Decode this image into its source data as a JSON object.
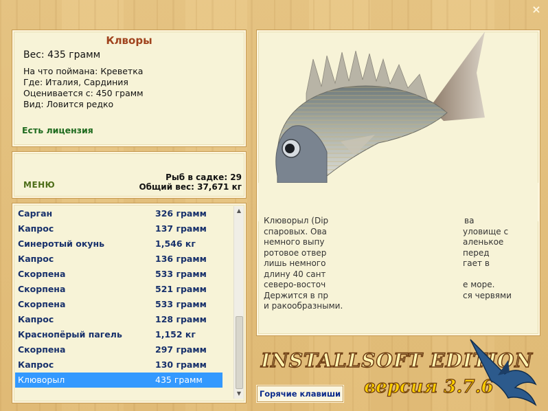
{
  "window": {
    "close_symbol": "×"
  },
  "catch": {
    "name": "Кл­воры­",
    "weight": "Вес: 435 грамм",
    "details": [
      "На что поймана: Креветка",
      "Где: Италия, Сардиния",
      "Оценивается с: 450 грамм",
      "Вид: Ловится редко"
    ],
    "license": "Есть лицензия"
  },
  "menu": {
    "label": "МЕНЮ",
    "cage_count": "Рыб в садке: 29",
    "total_weight": "Общий вес: 37,671 кг"
  },
  "catch_list": [
    {
      "name": "Сарган",
      "weight": "326 грамм"
    },
    {
      "name": "Капрос",
      "weight": "137 грамм"
    },
    {
      "name": "Синеротый окунь",
      "weight": "1,546 кг"
    },
    {
      "name": "Капрос",
      "weight": "136 грамм"
    },
    {
      "name": "Скорпена",
      "weight": "533 грамм"
    },
    {
      "name": "Скорпена",
      "weight": "521 грамм"
    },
    {
      "name": "Скорпена",
      "weight": "533 грамм"
    },
    {
      "name": "Капрос",
      "weight": "128 грамм"
    },
    {
      "name": "Краснопёрый пагель",
      "weight": "1,152 кг"
    },
    {
      "name": "Скорпена",
      "weight": "297 грамм"
    },
    {
      "name": "Капрос",
      "weight": "130 грамм"
    },
    {
      "name": "Клюворыл",
      "weight": "435 грамм",
      "selected": true
    }
  ],
  "description": [
    "Клюворыл (Dip",
    "спаровых. Ова",
    "немного выпу",
    "ротовое отвер",
    "лишь немного",
    "длину 40 сант",
    "северо-восточ",
    "Держится в пр",
    "и ракообразными."
  ],
  "description_right": [
    "ва",
    "уловище с",
    "аленькое",
    "перед",
    "гает в",
    "",
    "е море.",
    "ся червями",
    ""
  ],
  "branding": {
    "edition": "INSTALLSOFT EDITION",
    "version": "версия 3.7.6"
  },
  "hotkeys_label": "Горячие клавиши",
  "colors": {
    "title": "#a0431e",
    "license": "#1f6b1f",
    "menu": "#4d6d18",
    "list_text": "#17306b",
    "selection": "#3399ff",
    "panel_bg": "#f7f3d7"
  }
}
